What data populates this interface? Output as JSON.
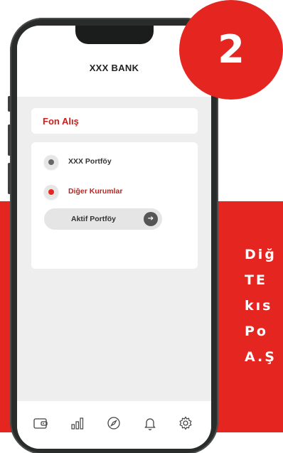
{
  "header": {
    "bank_name": "XXX BANK"
  },
  "page": {
    "title": "Fon Alış"
  },
  "options": [
    {
      "label": "XXX Portföy",
      "selected": false
    },
    {
      "label": "Diğer Kurumlar",
      "selected": true
    }
  ],
  "portfolio_button": {
    "label": "Aktif Portföy"
  },
  "tabbar": {
    "icons": [
      "wallet-icon",
      "chart-icon",
      "compass-icon",
      "bell-icon",
      "settings-icon"
    ]
  },
  "step_badge": {
    "number": "2"
  },
  "side_text": {
    "lines": [
      "Diğ",
      "TE",
      "kıs",
      "Po",
      "A.Ş"
    ]
  },
  "colors": {
    "accent": "#e52620",
    "label_red": "#c8201c",
    "grey_dot": "#666666"
  }
}
